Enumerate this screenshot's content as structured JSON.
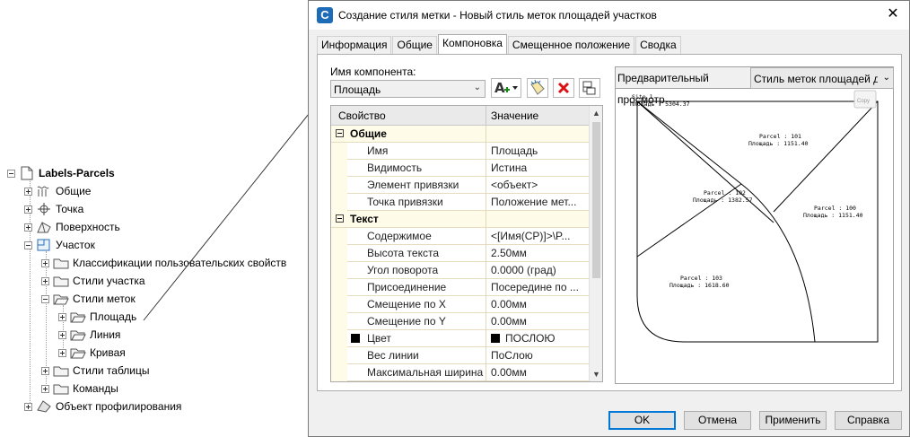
{
  "tree": {
    "root": "Labels-Parcels",
    "items": [
      {
        "label": "Общие"
      },
      {
        "label": "Точка"
      },
      {
        "label": "Поверхность"
      },
      {
        "label": "Участок"
      },
      {
        "label": "Классификации пользовательских свойств"
      },
      {
        "label": "Стили участка"
      },
      {
        "label": "Стили меток"
      },
      {
        "label": "Площадь"
      },
      {
        "label": "Линия"
      },
      {
        "label": "Кривая"
      },
      {
        "label": "Стили таблицы"
      },
      {
        "label": "Команды"
      },
      {
        "label": "Объект профилирования"
      }
    ]
  },
  "dialog": {
    "title": "Создание стиля метки - Новый стиль меток площадей участков",
    "close": "✕",
    "tabs": [
      {
        "label": "Информация"
      },
      {
        "label": "Общие"
      },
      {
        "label": "Компоновка"
      },
      {
        "label": "Смещенное положение"
      },
      {
        "label": "Сводка"
      }
    ],
    "active_tab": "Компоновка",
    "component_label": "Имя компонента:",
    "component_value": "Площадь",
    "grid": {
      "col_property": "Свойство",
      "col_value": "Значение",
      "groups": [
        {
          "name": "Общие",
          "rows": [
            {
              "name": "Имя",
              "value": "Площадь"
            },
            {
              "name": "Видимость",
              "value": "Истина"
            },
            {
              "name": "Элемент привязки",
              "value": "<объект>"
            },
            {
              "name": "Точка привязки",
              "value": "Положение мет..."
            }
          ]
        },
        {
          "name": "Текст",
          "rows": [
            {
              "name": "Содержимое",
              "value": "<[Имя(CP)]>\\P..."
            },
            {
              "name": "Высота текста",
              "value": "2.50мм"
            },
            {
              "name": "Угол поворота",
              "value": "0.0000 (град)"
            },
            {
              "name": "Присоединение",
              "value": "Посередине по ..."
            },
            {
              "name": "Смещение по X",
              "value": "0.00мм"
            },
            {
              "name": "Смещение по Y",
              "value": "0.00мм"
            },
            {
              "name": "Цвет",
              "value": "ПОСЛОЮ"
            },
            {
              "name": "Вес линии",
              "value": "ПоСлою"
            },
            {
              "name": "Максимальная ширина",
              "value": "0.00мм"
            }
          ]
        }
      ]
    },
    "preview": {
      "label": "Предварительный просмотр",
      "style_value": "Стиль меток площадей д",
      "copy_label": "Copy",
      "labels": {
        "site_name": "Site 1",
        "site_area": "Площадь : 5304.37",
        "p101_name": "Parcel : 101",
        "p101_area": "Площадь : 1151.40",
        "p102_name": "Parcel : 102",
        "p102_area": "Площадь : 1382.57",
        "p100_name": "Parcel : 100",
        "p100_area": "Площадь : 1151.40",
        "p103_name": "Parcel : 103",
        "p103_area": "Площадь : 1618.60"
      }
    },
    "buttons": {
      "ok": "OK",
      "cancel": "Отмена",
      "apply": "Применить",
      "help": "Справка"
    }
  }
}
